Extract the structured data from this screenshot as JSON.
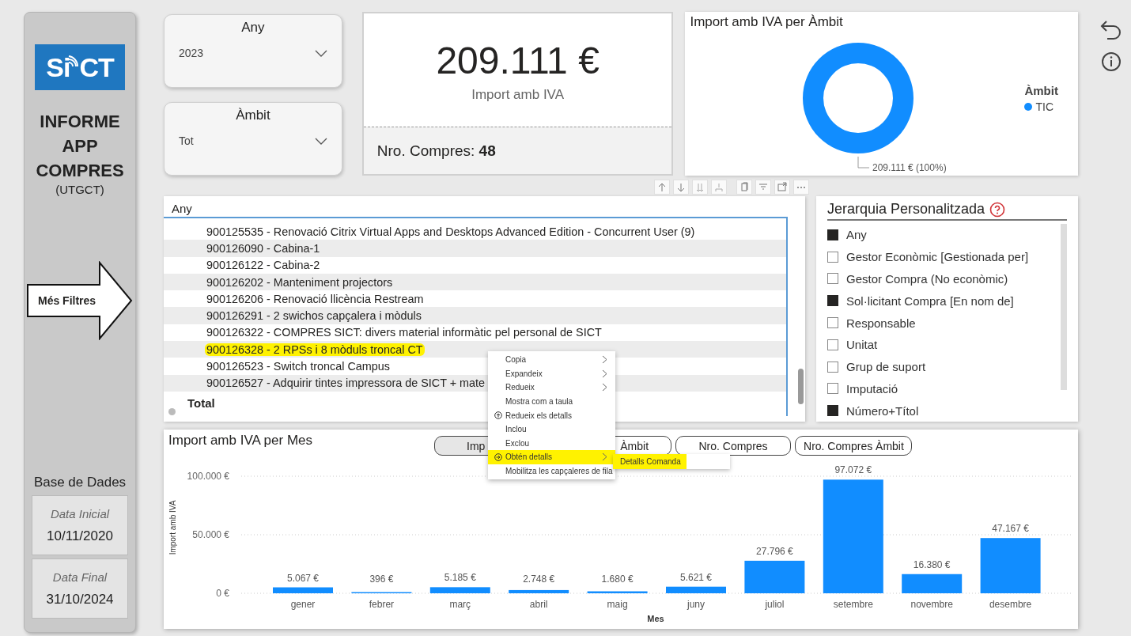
{
  "sidebar": {
    "logo": {
      "left": "Si",
      "right": "CT"
    },
    "title": "INFORME APP COMPRES",
    "subtitle": "(UTGCT)",
    "filters_arrow": "Més Filtres",
    "database": {
      "title": "Base de Dades",
      "dates": [
        {
          "label": "Data Inicial",
          "value": "10/11/2020"
        },
        {
          "label": "Data Final",
          "value": "31/10/2024"
        }
      ]
    }
  },
  "slicers": [
    {
      "title": "Any",
      "value": "2023"
    },
    {
      "title": "Àmbit",
      "value": "Tot"
    }
  ],
  "kpi": {
    "value": "209.111 €",
    "caption": "Import amb IVA",
    "footer": "Nro. Compres: **48**"
  },
  "donut": {
    "title": "Import amb IVA per Àmbit",
    "legend_title": "Àmbit",
    "legend": [
      {
        "label": "TIC",
        "color": "#118dff"
      }
    ],
    "data_label": "209.111 € (100%)"
  },
  "matrix": {
    "header": "Any",
    "rows": [
      {
        "text": "900125535 - Renovació Citrix Virtual Apps and Desktops Advanced Edition - Concurrent User (9)",
        "highlighted": false
      },
      {
        "text": "900126090 - Cabina-1",
        "highlighted": false
      },
      {
        "text": "900126122 - Cabina-2",
        "highlighted": false
      },
      {
        "text": "900126202 - Manteniment projectors",
        "highlighted": false
      },
      {
        "text": "900126206 - Renovació llicència Restream",
        "highlighted": false
      },
      {
        "text": "900126291 - 2 swichos capçalera i mòduls",
        "highlighted": false
      },
      {
        "text": "900126322 - COMPRES SICT: divers material informàtic pel personal de SICT",
        "highlighted": false
      },
      {
        "text": "900126328 - 2 RPSs i 8 mòduls troncal CT",
        "highlighted": true
      },
      {
        "text": "900126523 - Switch troncal Campus",
        "highlighted": false
      },
      {
        "text": "900126527 - Adquirir tintes impressora de SICT + mate",
        "highlighted": false
      }
    ],
    "total": "Total"
  },
  "hierarchy": {
    "title": "Jerarquia Personalitzada",
    "items": [
      {
        "label": "Any",
        "checked": true
      },
      {
        "label": "Gestor Econòmic [Gestionada per]",
        "checked": false
      },
      {
        "label": "Gestor Compra (No econòmic)",
        "checked": false
      },
      {
        "label": "Sol·licitant Compra [En nom de]",
        "checked": true
      },
      {
        "label": "Responsable",
        "checked": false
      },
      {
        "label": "Unitat",
        "checked": false
      },
      {
        "label": "Grup de suport",
        "checked": false
      },
      {
        "label": "Imputació",
        "checked": false
      },
      {
        "label": "Número+Títol",
        "checked": true
      }
    ]
  },
  "bar_chart": {
    "buttons": [
      {
        "label": "Imp",
        "selected": true
      },
      {
        "label": "Àmbit",
        "selected": false
      },
      {
        "label": "Nro. Compres",
        "selected": false
      },
      {
        "label": "Nro. Compres Àmbit",
        "selected": false
      }
    ],
    "chart_data": {
      "type": "bar",
      "title": "Import amb IVA per Mes",
      "xlabel": "Mes",
      "ylabel": "Import amb IVA",
      "categories": [
        "gener",
        "febrer",
        "març",
        "abril",
        "maig",
        "juny",
        "juliol",
        "setembre",
        "novembre",
        "desembre"
      ],
      "series": [
        {
          "color": "#118dff",
          "values": [
            5067,
            396,
            5185,
            2748,
            1680,
            5621,
            27796,
            97072,
            16380,
            47167
          ]
        }
      ],
      "ylim": [
        0,
        100000
      ],
      "yticks": [
        {
          "value": 0,
          "label": "0 €"
        },
        {
          "value": 50000,
          "label": "50.000 €"
        },
        {
          "value": 100000,
          "label": "100.000 €"
        }
      ],
      "value_labels": [
        "5.067 €",
        "396 €",
        "5.185 €",
        "2.748 €",
        "1.680 €",
        "5.621 €",
        "27.796 €",
        "97.072 €",
        "16.380 €",
        "47.167 €"
      ]
    }
  },
  "context_menu": {
    "items": [
      {
        "label": "Copia",
        "kind": "submenu",
        "highlighted": false
      },
      {
        "label": "Expandeix",
        "kind": "submenu",
        "highlighted": false
      },
      {
        "label": "Redueix",
        "kind": "submenu",
        "highlighted": false
      },
      {
        "label": "Mostra com a taula",
        "kind": "plain",
        "highlighted": false
      },
      {
        "label": "Redueix els detalls",
        "kind": "collapse",
        "highlighted": false
      },
      {
        "label": "Inclou",
        "kind": "plain",
        "highlighted": false
      },
      {
        "label": "Exclou",
        "kind": "plain",
        "highlighted": false
      },
      {
        "label": "Obtén detalls",
        "kind": "drill",
        "highlighted": true
      },
      {
        "label": "Mobilitza les capçaleres de fila",
        "kind": "plain",
        "highlighted": false
      }
    ],
    "submenu": {
      "label": "Detalls Comanda",
      "highlighted": true
    }
  }
}
